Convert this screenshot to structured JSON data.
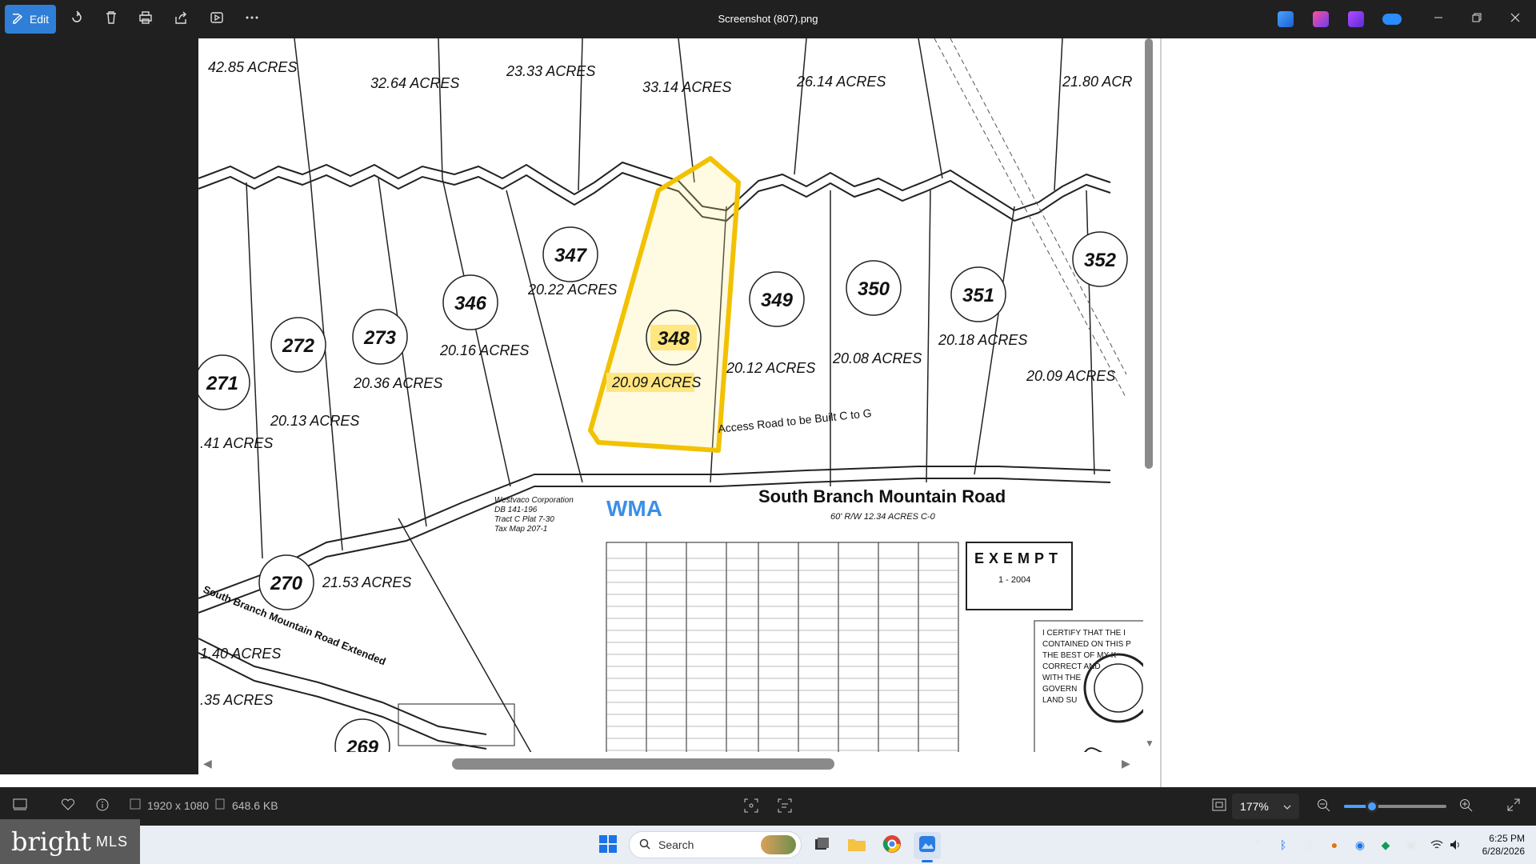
{
  "titlebar": {
    "file_title": "Screenshot (807).png",
    "edit_label": "Edit",
    "tools": [
      "rotate-icon",
      "delete-icon",
      "print-icon",
      "share-icon",
      "slideshow-icon",
      "more-icon"
    ]
  },
  "image": {
    "lots": [
      {
        "num": "271"
      },
      {
        "num": "272"
      },
      {
        "num": "273"
      },
      {
        "num": "346"
      },
      {
        "num": "347"
      },
      {
        "num": "348"
      },
      {
        "num": "349"
      },
      {
        "num": "350"
      },
      {
        "num": "351"
      },
      {
        "num": "352"
      },
      {
        "num": "270"
      },
      {
        "num": "269"
      }
    ],
    "acres": [
      "42.85 ACRES",
      "32.64 ACRES",
      "23.33 ACRES",
      "33.14 ACRES",
      "26.14 ACRES",
      "21.80 ACR",
      "20.22 ACRES",
      "20.16 ACRES",
      "20.36 ACRES",
      "20.13 ACRES",
      ".41 ACRES",
      "20.09 ACRES",
      "20.12 ACRES",
      "20.08 ACRES",
      "20.18 ACRES",
      "20.09 ACRES",
      "21.53 ACRES",
      "1.40 ACRES",
      ".35 ACRES"
    ],
    "road_label": "South Branch Mountain Road",
    "road_sub": "60' R/W  12.34 ACRES C-0",
    "access_road": "Access Road to be Built C to G",
    "extended_road": "South Branch Mountain Road Extended",
    "wma": "WMA",
    "westvaco": [
      "Westvaco Corporation",
      "DB 141-196",
      "Tract C  Plat 7-30",
      "Tax Map 207-1"
    ],
    "exempt": "EXEMPT",
    "exempt_date": "1 - 2004",
    "certify": [
      "I CERTIFY THAT THE I",
      "CONTAINED ON THIS P",
      "THE BEST OF MY K",
      "CORRECT AND",
      "WITH THE",
      "GOVERN",
      "LAND SU"
    ]
  },
  "statusbar": {
    "dimensions": "1920 x 1080",
    "filesize": "648.6 KB",
    "zoom": "177%",
    "zoom_level": 0.27
  },
  "taskbar": {
    "brand": "bright",
    "brand_suffix": "MLS",
    "search_placeholder": "Search",
    "time": "6:25 PM",
    "date": "6/28/2026"
  }
}
